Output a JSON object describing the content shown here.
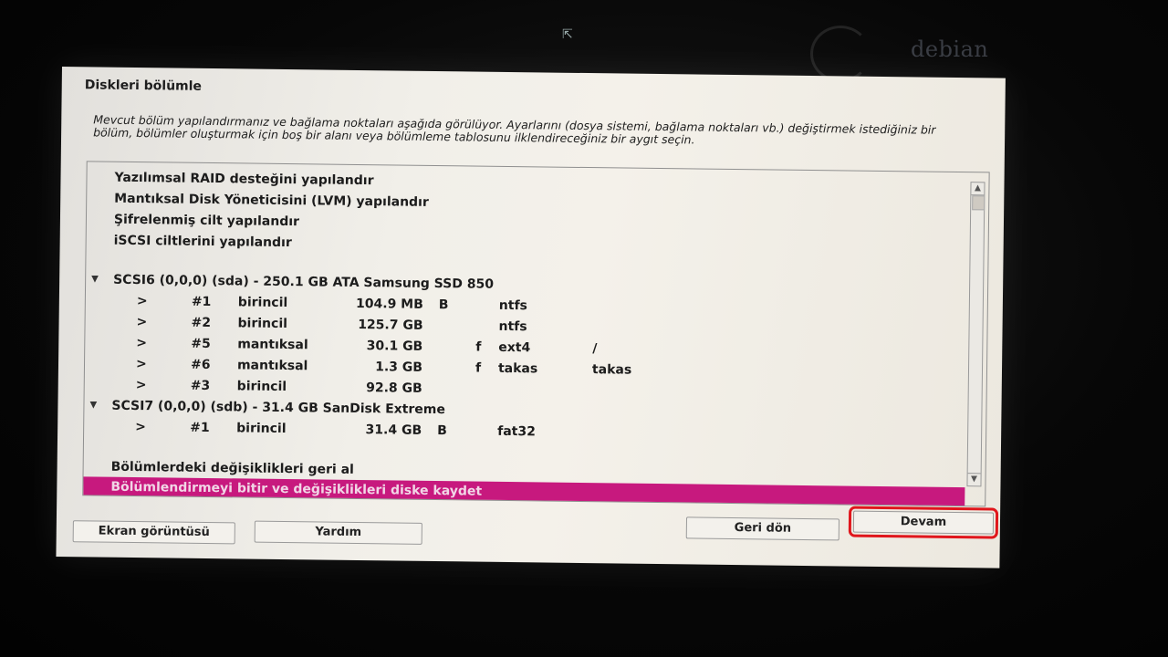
{
  "brand": {
    "wordmark": "debian"
  },
  "window": {
    "title": "Diskleri bölümle",
    "description": "Mevcut bölüm yapılandırmanız ve bağlama noktaları aşağıda görülüyor. Ayarlarını (dosya sistemi, bağlama noktaları vb.) değiştirmek istediğiniz bir bölüm, bölümler oluşturmak için boş bir alanı veya bölümleme tablosunu ilklendireceğiniz bir aygıt seçin."
  },
  "list": {
    "config_items": [
      "Yazılımsal RAID desteğini yapılandır",
      "Mantıksal Disk Yöneticisini (LVM) yapılandır",
      "Şifrelenmiş cilt yapılandır",
      "iSCSI ciltlerini yapılandır"
    ],
    "disks": [
      {
        "header": "SCSI6 (0,0,0) (sda) - 250.1 GB ATA Samsung SSD 850",
        "partitions": [
          {
            "arrow": ">",
            "num": "#1",
            "type": "birincil",
            "size": "104.9 MB",
            "flag1": "B",
            "flag2": "",
            "fs": "ntfs",
            "mount": ""
          },
          {
            "arrow": ">",
            "num": "#2",
            "type": "birincil",
            "size": "125.7 GB",
            "flag1": "",
            "flag2": "",
            "fs": "ntfs",
            "mount": ""
          },
          {
            "arrow": ">",
            "num": "#5",
            "type": "mantıksal",
            "size": "30.1 GB",
            "flag1": "",
            "flag2": "f",
            "fs": "ext4",
            "mount": "/"
          },
          {
            "arrow": ">",
            "num": "#6",
            "type": "mantıksal",
            "size": "1.3 GB",
            "flag1": "",
            "flag2": "f",
            "fs": "takas",
            "mount": "takas"
          },
          {
            "arrow": ">",
            "num": "#3",
            "type": "birincil",
            "size": "92.8 GB",
            "flag1": "",
            "flag2": "",
            "fs": "",
            "mount": ""
          }
        ]
      },
      {
        "header": "SCSI7 (0,0,0) (sdb) - 31.4 GB SanDisk Extreme",
        "partitions": [
          {
            "arrow": ">",
            "num": "#1",
            "type": "birincil",
            "size": "31.4 GB",
            "flag1": "B",
            "flag2": "",
            "fs": "fat32",
            "mount": ""
          }
        ]
      }
    ],
    "actions": [
      "Bölümlerdeki değişiklikleri geri al",
      "Bölümlendirmeyi bitir ve değişiklikleri diske kaydet"
    ],
    "selected_action_index": 1
  },
  "buttons": {
    "screenshot": "Ekran görüntüsü",
    "help": "Yardım",
    "back": "Geri dön",
    "continue": "Devam"
  },
  "colors": {
    "selection": "#c7197e",
    "highlight_box": "#e0161c"
  }
}
